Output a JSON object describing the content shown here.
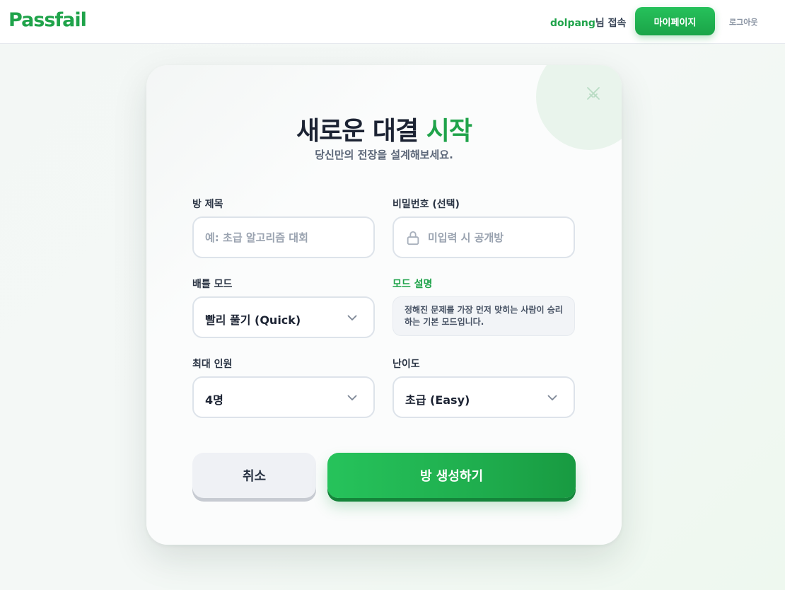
{
  "header": {
    "logo": "Passfail",
    "username": "dolpang",
    "greeting_suffix": "님 접속",
    "mypage_label": "마이페이지",
    "logout_label": "로그아웃"
  },
  "card": {
    "decor_icon": "crossed-swords-icon",
    "title_main": "새로운 대결 ",
    "title_accent": "시작",
    "subtitle": "당신만의 전장을 설계해보세요."
  },
  "form": {
    "room_title": {
      "label": "방 제목",
      "value": "",
      "placeholder": "예: 초급 알고리즘 대회"
    },
    "password": {
      "label": "비밀번호 (선택)",
      "value": "",
      "placeholder": "미입력 시 공개방",
      "icon": "lock-icon"
    },
    "battle_mode": {
      "label": "배틀 모드",
      "value": "빨리 풀기 (Quick)"
    },
    "mode_desc": {
      "label": "모드 설명",
      "text": "정해진 문제를 가장 먼저 맞히는 사람이 승리하는 기본 모드입니다."
    },
    "max_players": {
      "label": "최대 인원",
      "value": "4명"
    },
    "difficulty": {
      "label": "난이도",
      "value": "초급 (Easy)"
    }
  },
  "actions": {
    "cancel_label": "취소",
    "create_label": "방 생성하기"
  },
  "colors": {
    "accent": "#1fa34a",
    "text_dark": "#1c2333"
  }
}
